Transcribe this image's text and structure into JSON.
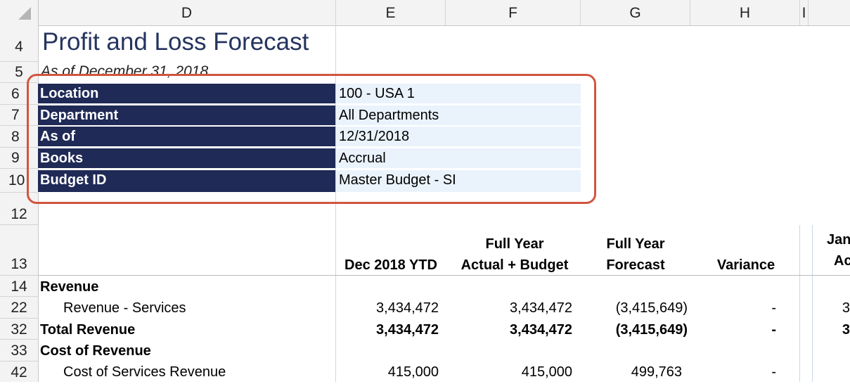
{
  "column_headers": [
    "D",
    "E",
    "F",
    "G",
    "H",
    "I"
  ],
  "row_headers": [
    "4",
    "5",
    "6",
    "7",
    "8",
    "9",
    "10",
    "12",
    "13",
    "14",
    "22",
    "32",
    "33",
    "42"
  ],
  "report": {
    "title": "Profit and Loss Forecast",
    "subtitle": "As of December 31, 2018"
  },
  "parameters": [
    {
      "label": "Location",
      "value": "100 - USA 1"
    },
    {
      "label": "Department",
      "value": "All Departments"
    },
    {
      "label": "As of",
      "value": "12/31/2018"
    },
    {
      "label": "Books",
      "value": "Accrual"
    },
    {
      "label": "Budget ID",
      "value": "Master Budget - SI"
    }
  ],
  "table": {
    "headers": {
      "ytd": "Dec 2018 YTD",
      "fy_actual_line1": "Full Year",
      "fy_actual_line2": "Actual + Budget",
      "fy_forecast_line1": "Full Year",
      "fy_forecast_line2": "Forecast",
      "variance": "Variance",
      "partial_line1": "Jan",
      "partial_line2": "Ac"
    },
    "rows": [
      {
        "label": "Revenue",
        "ytd": "",
        "fy_actual": "",
        "forecast": "",
        "variance": "",
        "partial": ""
      },
      {
        "label": "Revenue - Services",
        "ytd": "3,434,472",
        "fy_actual": "3,434,472",
        "forecast": "(3,415,649)",
        "variance": "-",
        "partial": "3"
      },
      {
        "label": "Total Revenue",
        "ytd": "3,434,472",
        "fy_actual": "3,434,472",
        "forecast": "(3,415,649)",
        "variance": "-",
        "partial": "3"
      },
      {
        "label": "Cost of Revenue",
        "ytd": "",
        "fy_actual": "",
        "forecast": "",
        "variance": "",
        "partial": ""
      },
      {
        "label": "Cost of Services Revenue",
        "ytd": "415,000",
        "fy_actual": "415,000",
        "forecast": "499,763",
        "variance": "-",
        "partial": ""
      }
    ]
  },
  "colors": {
    "param_label_bg": "#1f2a56",
    "param_value_bg": "#eaf3fc",
    "title_color": "#25345f",
    "highlight_border": "#d2553f"
  }
}
